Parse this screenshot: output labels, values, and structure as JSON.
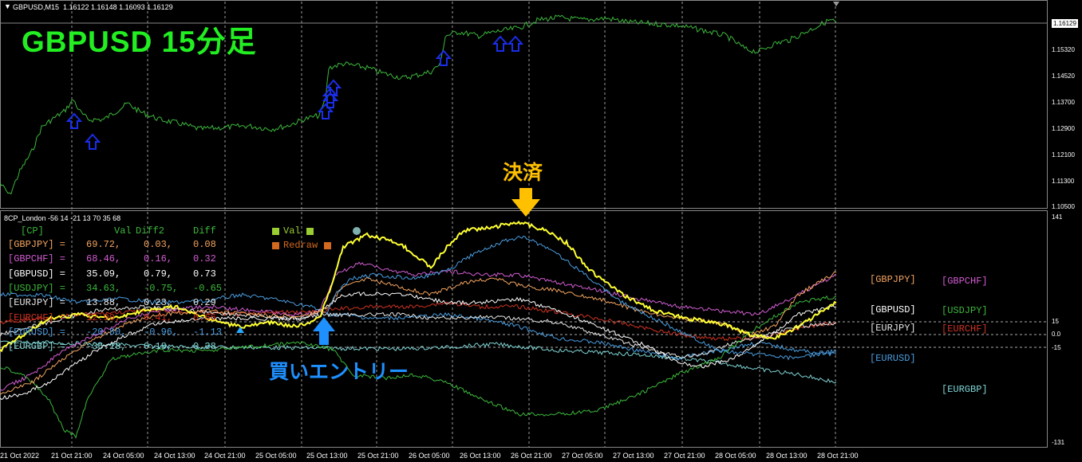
{
  "window": {
    "symbol_line": "GBPUSD,M15  1.16122 1.16148 1.16093 1.16129",
    "indicator_line": "8CP_London -56 14 -21 13 70 35 68"
  },
  "annotations": {
    "title": "GBPUSD 15分足",
    "exit_label": "決済",
    "entry_label": "買いエントリー"
  },
  "price_axis": {
    "ticks": [
      "1.16129",
      "1.15320",
      "1.14520",
      "1.13700",
      "1.12900",
      "1.12100",
      "1.11300",
      "1.10500"
    ],
    "current": "1.16129"
  },
  "indicator_axis": {
    "ticks": [
      "141",
      "15",
      "0.0",
      "-15",
      "-131"
    ]
  },
  "time_axis": {
    "ticks": [
      "21 Oct 2022",
      "21 Oct 21:00",
      "24 Oct 05:00",
      "24 Oct 13:00",
      "24 Oct 21:00",
      "25 Oct 05:00",
      "25 Oct 13:00",
      "25 Oct 21:00",
      "26 Oct 05:00",
      "26 Oct 13:00",
      "26 Oct 21:00",
      "27 Oct 05:00",
      "27 Oct 13:00",
      "27 Oct 21:00",
      "28 Oct 05:00",
      "28 Oct 13:00",
      "28 Oct 21:00"
    ]
  },
  "table": {
    "header": [
      "[CP]",
      "Val",
      "Diff2",
      "Diff"
    ],
    "rows": [
      {
        "pair": "[GBPJPY] =",
        "val": "69.72,",
        "diff2": "0.03,",
        "diff": "0.08",
        "color": "#f4a460"
      },
      {
        "pair": "[GBPCHF] =",
        "val": "68.46,",
        "diff2": "0.16,",
        "diff": "0.32",
        "color": "#d25cd2"
      },
      {
        "pair": "[GBPUSD] =",
        "val": "35.09,",
        "diff2": "0.79,",
        "diff": "0.73",
        "color": "#ffffff"
      },
      {
        "pair": "[USDJPY] =",
        "val": "34.63,",
        "diff2": "-0.75,",
        "diff": "-0.65",
        "color": "#3cb83c"
      },
      {
        "pair": "[EURJPY] =",
        "val": "13.88,",
        "diff2": "0.23,",
        "diff": "0.29",
        "color": "#e6e6e6"
      },
      {
        "pair": "[EURCHF] =",
        "val": "12.90,",
        "diff2": "0.41,",
        "diff": "0.66",
        "color": "#cc3322"
      },
      {
        "pair": "[EURUSD] =",
        "val": "-20.80,",
        "diff2": "-0.96,",
        "diff": "-1.13",
        "color": "#4a9de0"
      },
      {
        "pair": "[EURGBP] =",
        "val": "-36.18,",
        "diff2": "0.18,",
        "diff": "0.38",
        "color": "#7fd4d4"
      }
    ]
  },
  "legend": {
    "val_label": "Val",
    "redraw_label": "Redraw",
    "val_color": "#9acd32",
    "redraw_color": "#d2691e"
  },
  "pair_tags": [
    {
      "label": "[GBPJPY]",
      "color": "#f4a460"
    },
    {
      "label": "[GBPCHF]",
      "color": "#d25cd2"
    },
    {
      "label": "[GBPUSD]",
      "color": "#ffffff"
    },
    {
      "label": "[USDJPY]",
      "color": "#3cb83c"
    },
    {
      "label": "[EURJPY]",
      "color": "#e6e6e6"
    },
    {
      "label": "[EURCHF]",
      "color": "#cc3322"
    },
    {
      "label": "[EURUSD]",
      "color": "#4a9de0"
    },
    {
      "label": "[EURGBP]",
      "color": "#7fd4d4"
    }
  ],
  "colors": {
    "background": "#000000",
    "price_line": "#3cb83c",
    "buy_arrow": "#1a2ee8",
    "exit_marker": "#ffc000",
    "entry_marker": "#1e90ff",
    "gbpusd_strength": "#ffff33"
  }
}
